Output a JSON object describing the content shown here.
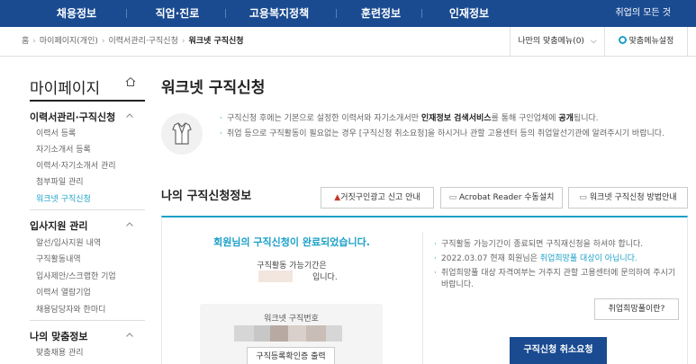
{
  "topnav": {
    "items": [
      "채용정보",
      "직업·진로",
      "고용복지정책",
      "훈련정보",
      "인재정보"
    ],
    "all_menu": "취업의 모든 것"
  },
  "breadcrumb": {
    "items": [
      "홈",
      "마이페이지(개인)",
      "이력서관리·구직신청",
      "워크넷 구직신청"
    ],
    "my_menu": "나만의 맞춤메뉴(0)",
    "menu_setting": "맞춤메뉴설정"
  },
  "sidebar": {
    "title": "마이페이지",
    "sections": [
      {
        "title": "이력서관리·구직신청",
        "links": [
          "이력서 등록",
          "자기소개서 등록",
          "이력서·자기소개서 관리",
          "첨부파일 관리",
          "워크넷 구직신청"
        ],
        "active": 4
      },
      {
        "title": "입사지원 관리",
        "links": [
          "알선/입사지원 내역",
          "구직활동내역",
          "입사제안/스크랩한 기업",
          "이력서 열람기업",
          "채용담당자와 한마디"
        ]
      },
      {
        "title": "나의 맞춤정보",
        "links": [
          "맞춤채용 관리"
        ]
      }
    ]
  },
  "main": {
    "title": "워크넷 구직신청",
    "notice": {
      "line1_pre": "구직신청 후에는 기본으로 설정한 이력서와 자기소개서만 ",
      "line1_b1": "인재정보 검색서비스",
      "line1_mid": "를 통해 구인업체에 ",
      "line1_b2": "공개",
      "line1_post": "됩니다.",
      "line2": "취업 등으로 구직활동이 필요없는 경우 [구직신청 취소요청]을 하시거나 관할 고용센터 등의 취업알선기관에 알려주시기 바랍니다."
    },
    "subtitle": "나의 구직신청정보",
    "buttons": {
      "fake_ad": "거짓구인광고 신고 안내",
      "acrobat": "Acrobat Reader 수동설치",
      "guide": "워크넷 구직신청 방법안내"
    },
    "card": {
      "complete_pre": "회원님의 ",
      "complete_bold": "구직신청이 완료되었습니다.",
      "period_label": "구직활동 가능기간은",
      "period_until": "입니다.",
      "reg_no_label": "워크넷 구직번호",
      "print_button": "구직등록확인증 출력",
      "right_items": [
        "구직활동 가능기간이 종료되면 구직재신청을 하셔야 합니다.",
        "2022.03.07 현재 회원님은 취업희망풀 대상이 아닙니다.",
        "취업희망풀 대상 자격여부는 거주지 관할 고용센터에 문의하여 주시기 바랍니다."
      ],
      "right_item2_pre": "2022.03.07 현재 회원님은 ",
      "right_item2_hl": "취업희망풀 대상이 아닙니다.",
      "hope_button": "취업희망풀이란?",
      "cancel_button": "구직신청 취소요청"
    }
  },
  "colors": {
    "nav_bg": "#1a4b91",
    "accent": "#1ba0c8",
    "fake_ad_icon": "#c0392b"
  }
}
